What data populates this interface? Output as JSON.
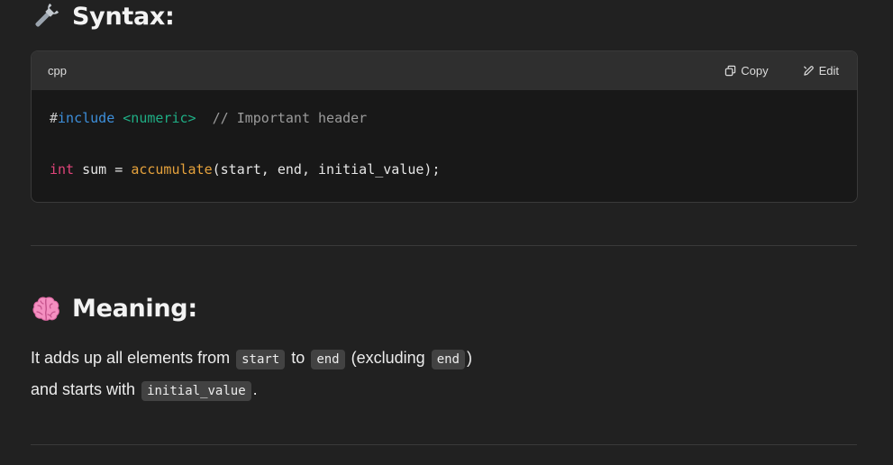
{
  "syntax_section": {
    "icon": "wrench-icon",
    "title": "Syntax:"
  },
  "code_block": {
    "language": "cpp",
    "copy_label": "Copy",
    "edit_label": "Edit",
    "lines": [
      {
        "hash": "#",
        "directive": "include",
        "header": "<numeric>",
        "comment": "// Important header"
      },
      {
        "type": "int",
        "var": "sum",
        "op": "=",
        "func": "accumulate",
        "args": "(start, end, initial_value);"
      }
    ]
  },
  "meaning_section": {
    "icon": "brain-icon",
    "title": "Meaning:",
    "line1": {
      "t1": "It adds up all elements from",
      "c1": "start",
      "t2": "to",
      "c2": "end",
      "t3": "(excluding",
      "c3": "end",
      "t4": ")"
    },
    "line2": {
      "t1": "and starts with",
      "c1": "initial_value",
      "t2": "."
    }
  },
  "colors": {
    "background": "#212121",
    "code_bg": "#181818",
    "code_header_bg": "#2f2f2f",
    "directive": "#3d8fdb",
    "header": "#1fae85",
    "keyword_type": "#e0447a",
    "function": "#e6a23c",
    "comment": "#9b9b9b"
  }
}
